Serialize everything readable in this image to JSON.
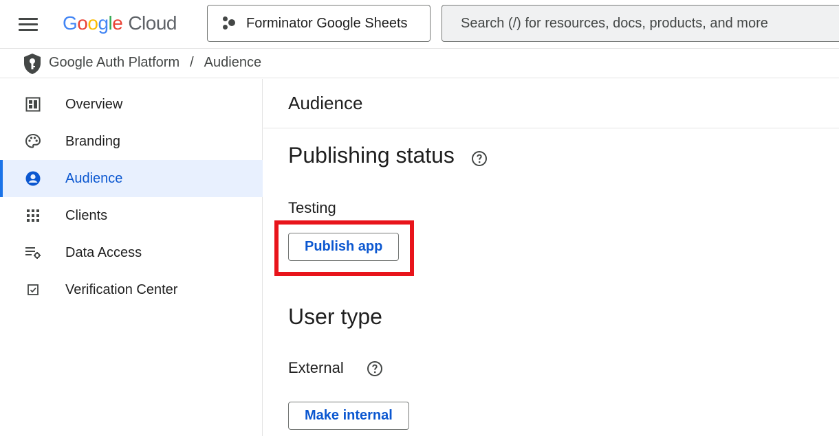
{
  "topbar": {
    "logo": {
      "g1": "G",
      "o1": "o",
      "o2": "o",
      "g2": "g",
      "l": "l",
      "e": "e",
      "cloud": "Cloud"
    },
    "project_name": "Forminator Google Sheets",
    "search_placeholder": "Search (/) for resources, docs, products, and more"
  },
  "breadcrumb": {
    "items": [
      "Google Auth Platform",
      "Audience"
    ],
    "separator": "/"
  },
  "sidebar": {
    "items": [
      {
        "label": "Overview",
        "icon": "dashboard-icon"
      },
      {
        "label": "Branding",
        "icon": "palette-icon"
      },
      {
        "label": "Audience",
        "icon": "account-circle-icon",
        "active": true
      },
      {
        "label": "Clients",
        "icon": "apps-grid-icon"
      },
      {
        "label": "Data Access",
        "icon": "list-settings-icon"
      },
      {
        "label": "Verification Center",
        "icon": "checkbox-icon"
      }
    ]
  },
  "main": {
    "page_title": "Audience",
    "publishing": {
      "title": "Publishing status",
      "status": "Testing",
      "button": "Publish app"
    },
    "user_type": {
      "title": "User type",
      "value": "External",
      "button": "Make internal"
    }
  },
  "colors": {
    "accent": "#0b57d0",
    "active_bg": "#e8f0fe",
    "highlight": "#e8141b"
  }
}
